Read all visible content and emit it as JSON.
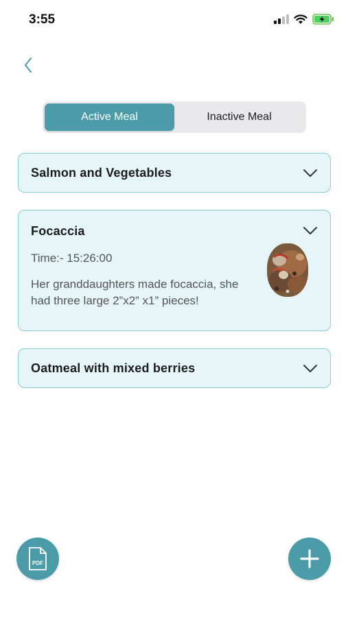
{
  "status_bar": {
    "time": "3:55",
    "icons": [
      "cellular-signal-icon",
      "wifi-icon",
      "battery-charging-icon"
    ]
  },
  "nav": {
    "back_icon": "chevron-left-icon"
  },
  "segmented_control": {
    "active_label": "Active Meal",
    "inactive_label": "Inactive Meal",
    "selected": "Active Meal"
  },
  "meals": [
    {
      "title": "Salmon and Vegetables",
      "expanded": false
    },
    {
      "title": "Focaccia",
      "expanded": true,
      "time": "Time:- 15:26:00",
      "description": "Her granddaughters made focaccia, she had three large 2”x2” x1” pieces!",
      "has_photo": true
    },
    {
      "title": "Oatmeal with mixed berries",
      "expanded": false
    }
  ],
  "actions": {
    "pdf_icon": "pdf-file-icon",
    "pdf_icon_text": "PDF",
    "add_icon": "plus-icon"
  },
  "colors": {
    "accent": "#4b9ba8",
    "card_background": "#e6f5f8",
    "card_border": "#8ccbd3",
    "segment_background": "#e9e9ec"
  }
}
